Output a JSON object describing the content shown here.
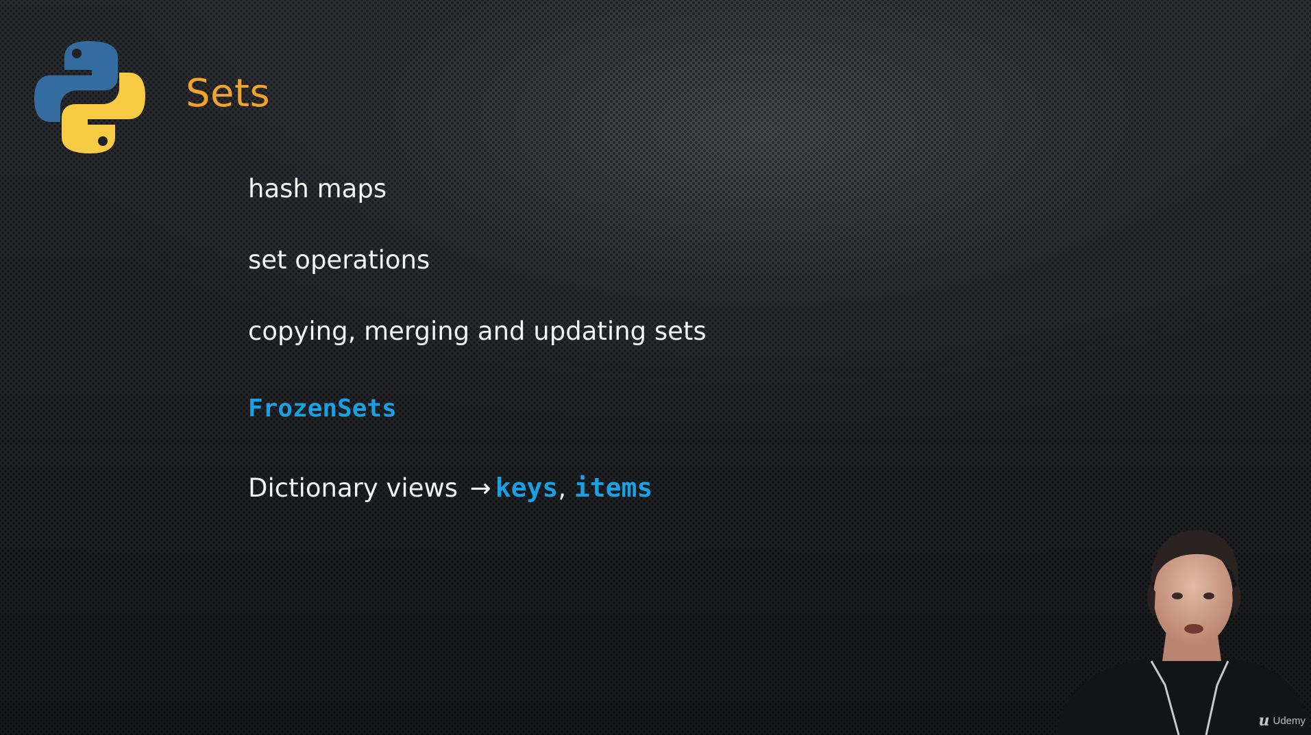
{
  "slide": {
    "title": "Sets",
    "logo_icon": "python-logo-icon",
    "bullets": [
      {
        "text": "hash maps"
      },
      {
        "text": "set operations"
      },
      {
        "text": "copying, merging and updating sets"
      },
      {
        "code": "FrozenSets"
      },
      {
        "text": "Dictionary views",
        "arrow": "→",
        "code1": "keys",
        "separator": ",",
        "code2": "items"
      }
    ]
  },
  "watermark": {
    "icon": "udemy-logo-icon",
    "label": "Udemy"
  },
  "colors": {
    "title": "#f0a42e",
    "body_text": "#f4f4f4",
    "code": "#1ba0e2",
    "python_blue": "#356c9f",
    "python_yellow": "#f7cb43"
  }
}
